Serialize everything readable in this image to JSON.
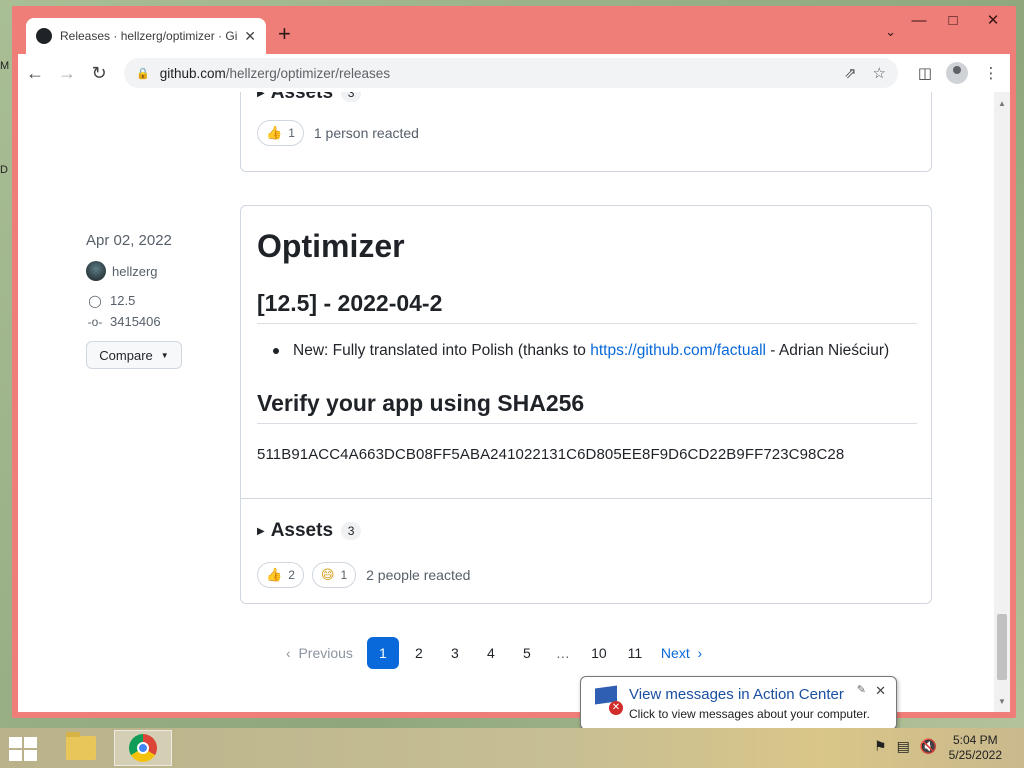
{
  "browser": {
    "tab_title": "Releases · hellzerg/optimizer · Gi",
    "url_host": "github.com",
    "url_path": "/hellzerg/optimizer/releases",
    "colors": {
      "frame": "#ee7e77",
      "link": "#0969da"
    }
  },
  "previous_release": {
    "assets_label": "Assets",
    "assets_count": "3",
    "reactions": [
      {
        "emoji": "👍",
        "count": "1"
      }
    ],
    "reaction_text": "1 person reacted"
  },
  "release": {
    "date": "Apr 02, 2022",
    "author": "hellzerg",
    "tag": "12.5",
    "commit": "3415406",
    "compare_label": "Compare",
    "title": "Optimizer",
    "version_heading": "[12.5] - 2022-04-2",
    "bullet_prefix": "New: Fully translated into Polish (thanks to ",
    "bullet_link": "https://github.com/factuall",
    "bullet_suffix": " - Adrian Nieściur)",
    "verify_heading": "Verify your app using SHA256",
    "sha256": "511B91ACC4A663DCB08FF5ABA241022131C6D805EE8F9D6CD22B9FF723C98C28",
    "assets_label": "Assets",
    "assets_count": "3",
    "reactions": [
      {
        "emoji": "👍",
        "count": "2"
      },
      {
        "emoji": "😄",
        "count": "1"
      }
    ],
    "reaction_text": "2 people reacted"
  },
  "pagination": {
    "previous": "Previous",
    "pages": [
      "1",
      "2",
      "3",
      "4",
      "5",
      "…",
      "10",
      "11"
    ],
    "current": "1",
    "next": "Next"
  },
  "notification": {
    "title": "View messages in Action Center",
    "subtitle": "Click to view messages about your computer."
  },
  "taskbar": {
    "time": "5:04 PM",
    "date": "5/25/2022"
  },
  "desktop": {
    "letters": [
      "M",
      "D"
    ]
  }
}
